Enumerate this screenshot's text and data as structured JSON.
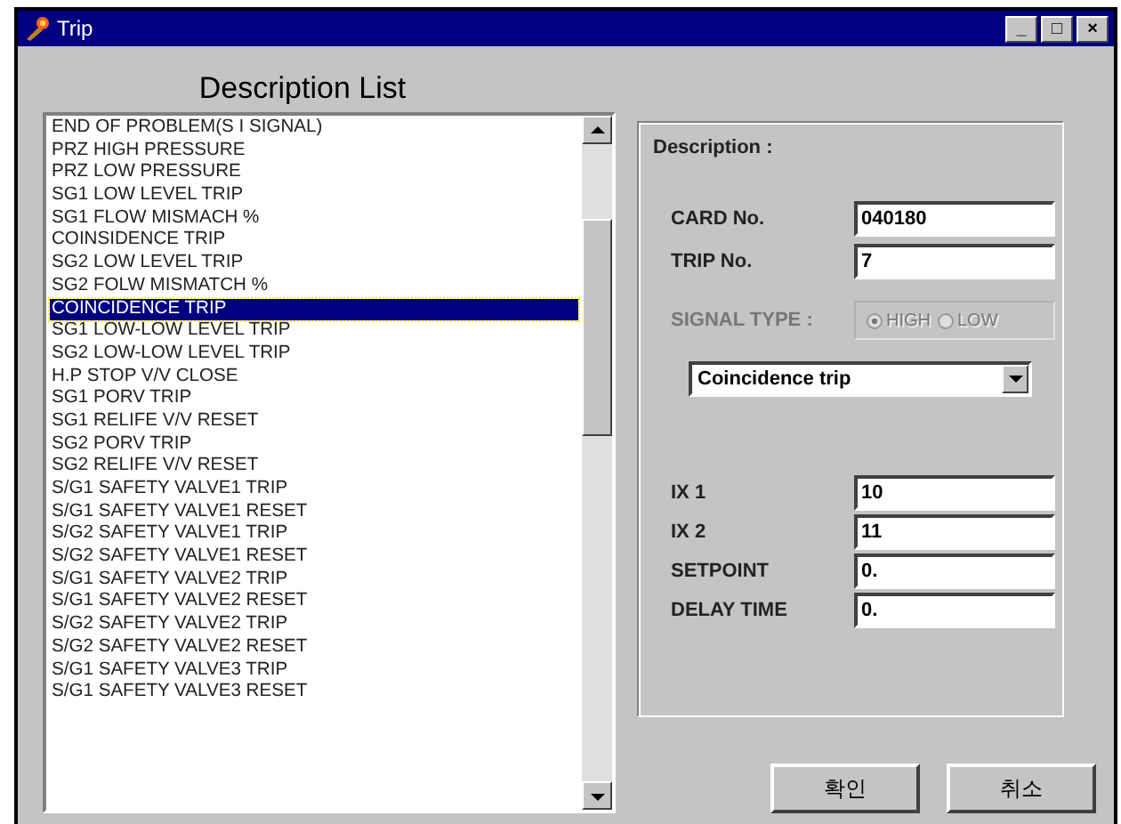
{
  "window": {
    "title": "Trip",
    "controls": [
      "_",
      "□",
      "×"
    ]
  },
  "list": {
    "heading": "Description List",
    "items": [
      {
        "label": "END OF PROBLEM(S I SIGNAL)",
        "selected": false
      },
      {
        "label": "PRZ HIGH PRESSURE",
        "selected": false
      },
      {
        "label": "PRZ LOW PRESSURE",
        "selected": false
      },
      {
        "label": "SG1 LOW LEVEL TRIP",
        "selected": false
      },
      {
        "label": "SG1 FLOW MISMACH  %",
        "selected": false
      },
      {
        "label": "COINSIDENCE TRIP",
        "selected": false
      },
      {
        "label": "SG2 LOW LEVEL TRIP",
        "selected": false
      },
      {
        "label": "SG2 FOLW MISMATCH %",
        "selected": false
      },
      {
        "label": "COINCIDENCE TRIP",
        "selected": true
      },
      {
        "label": "SG1 LOW-LOW LEVEL TRIP",
        "selected": false
      },
      {
        "label": "SG2 LOW-LOW LEVEL TRIP",
        "selected": false
      },
      {
        "label": "H.P STOP V/V CLOSE",
        "selected": false
      },
      {
        "label": "SG1 PORV TRIP",
        "selected": false
      },
      {
        "label": "SG1 RELIFE V/V RESET",
        "selected": false
      },
      {
        "label": "SG2 PORV TRIP",
        "selected": false
      },
      {
        "label": "SG2 RELIFE V/V RESET",
        "selected": false
      },
      {
        "label": "S/G1 SAFETY VALVE1 TRIP",
        "selected": false
      },
      {
        "label": "S/G1 SAFETY VALVE1 RESET",
        "selected": false
      },
      {
        "label": "S/G2 SAFETY VALVE1 TRIP",
        "selected": false
      },
      {
        "label": "S/G2 SAFETY VALVE1 RESET",
        "selected": false
      },
      {
        "label": "S/G1 SAFETY VALVE2 TRIP",
        "selected": false
      },
      {
        "label": "S/G1 SAFETY VALVE2 RESET",
        "selected": false
      },
      {
        "label": "S/G2 SAFETY VALVE2 TRIP",
        "selected": false
      },
      {
        "label": "S/G2 SAFETY VALVE2 RESET",
        "selected": false
      },
      {
        "label": "S/G1 SAFETY VALVE3 TRIP",
        "selected": false
      },
      {
        "label": "S/G1 SAFETY VALVE3 RESET",
        "selected": false
      }
    ]
  },
  "description": {
    "title": "Description :",
    "top_fields": [
      {
        "label": "CARD No.",
        "value": "040180"
      },
      {
        "label": "TRIP No.",
        "value": "7"
      }
    ],
    "signal_type": {
      "label": "SIGNAL TYPE :",
      "disabled": true,
      "options": [
        {
          "label": "HIGH",
          "selected": true
        },
        {
          "label": "LOW",
          "selected": false
        }
      ]
    },
    "dropdown": {
      "value": "Coincidence trip"
    },
    "fields": [
      {
        "label": "IX 1",
        "value": "10"
      },
      {
        "label": "IX 2",
        "value": "11"
      },
      {
        "label": "SETPOINT",
        "value": "0."
      },
      {
        "label": "DELAY TIME",
        "value": "0."
      }
    ]
  },
  "buttons": [
    "확인",
    "취소"
  ]
}
